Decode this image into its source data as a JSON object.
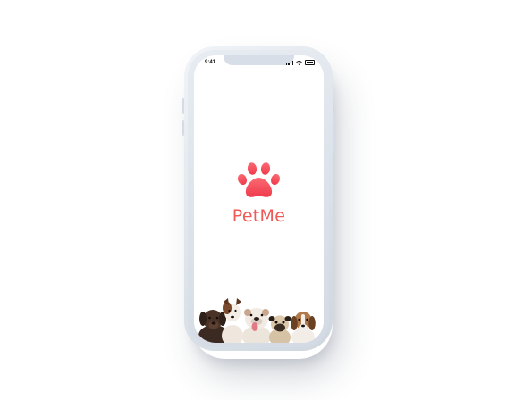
{
  "status_bar": {
    "time": "9:41",
    "signal_icon": "signal-icon",
    "wifi_icon": "wifi-icon",
    "battery_icon": "battery-icon"
  },
  "app": {
    "name": "PetMe",
    "logo_icon": "paw-icon",
    "name_color": "#ef5a58",
    "logo_color": "#f34f5c"
  },
  "illustration": {
    "subject": "dogs-group-icon",
    "dogs": [
      "brown-labrador",
      "jack-russell",
      "bulldog",
      "pug",
      "beagle"
    ]
  }
}
